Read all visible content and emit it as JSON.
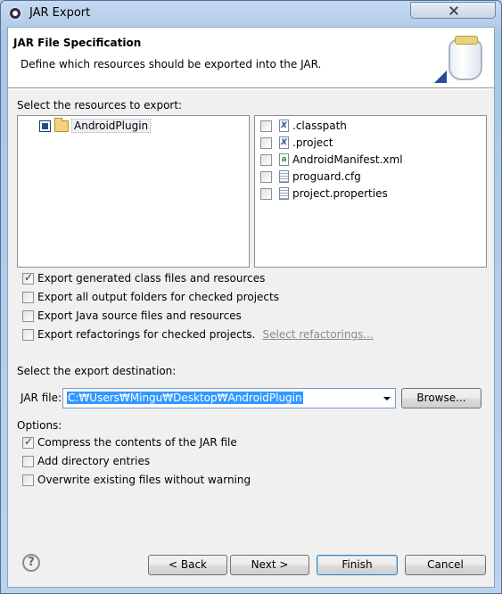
{
  "window": {
    "title": "JAR Export"
  },
  "banner": {
    "title": "JAR File Specification",
    "description": "Define which resources should be exported into the JAR."
  },
  "resources": {
    "label": "Select the resources to export:",
    "tree": [
      {
        "label": "AndroidPlugin",
        "state": "partial"
      }
    ],
    "files": [
      {
        "name": ".classpath",
        "icon": "xml-file-icon",
        "checked": false
      },
      {
        "name": ".project",
        "icon": "xml-file-icon",
        "checked": false
      },
      {
        "name": "AndroidManifest.xml",
        "icon": "android-manifest-icon",
        "checked": false
      },
      {
        "name": "proguard.cfg",
        "icon": "text-file-icon",
        "checked": false
      },
      {
        "name": "project.properties",
        "icon": "text-file-icon",
        "checked": false
      }
    ]
  },
  "export_options": [
    {
      "label": "Export generated class files and resources",
      "checked": true
    },
    {
      "label": "Export all output folders for checked projects",
      "checked": false
    },
    {
      "label": "Export Java source files and resources",
      "checked": false
    },
    {
      "label": "Export refactorings for checked projects.",
      "checked": false,
      "link": "Select refactorings..."
    }
  ],
  "destination": {
    "label": "Select the export destination:",
    "jar_label": "JAR file:",
    "jar_value": "C:₩Users₩Mingu₩Desktop₩AndroidPlugin",
    "browse": "Browse..."
  },
  "options": {
    "label": "Options:",
    "items": [
      {
        "label": "Compress the contents of the JAR file",
        "checked": true
      },
      {
        "label": "Add directory entries",
        "checked": false
      },
      {
        "label": "Overwrite existing files without warning",
        "checked": false
      }
    ]
  },
  "buttons": {
    "back": "< Back",
    "next": "Next >",
    "finish": "Finish",
    "cancel": "Cancel",
    "help": "?"
  }
}
